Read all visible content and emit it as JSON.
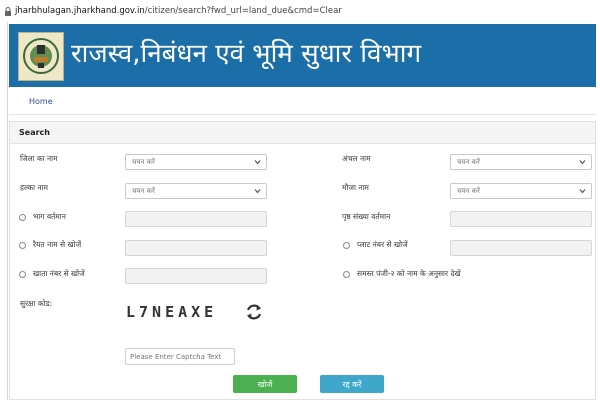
{
  "browser": {
    "url_host": "jharbhulagan.jharkhand.gov.in",
    "url_path": "/citizen/search?fwd_url=land_due&cmd=Clear"
  },
  "header": {
    "title": "राजस्व,निबंधन एवं भूमि सुधार विभाग"
  },
  "nav": {
    "home_label": "Home"
  },
  "search": {
    "heading": "Search",
    "district_label": "जिला का नाम",
    "district_value": "चयन करें",
    "circle_label": "अंचल नाम",
    "circle_value": "चयन करें",
    "halka_label": "हल्का नाम",
    "halka_value": "चयन करें",
    "mauza_label": "मौजा नाम",
    "mauza_value": "चयन करें",
    "bhag_label": "भाग वर्तमान",
    "page_label": "पृष्ठ संख्या वर्तमान",
    "raiyat_label": "रैयत नाम से खोजें",
    "plot_label": "प्लाट नंबर से खोजें",
    "khata_label": "खाता नंबर से खोजें",
    "panji_label": "समस्त पंजी-२ को नाम के अनुसार देखें",
    "captcha_label": "सुरक्षा कोड:",
    "captcha_value": "L7NEAXE",
    "captcha_placeholder": "Please Enter Captcha Text",
    "search_button": "खोजें",
    "cancel_button": "रद्द करें"
  },
  "colors": {
    "banner": "#1b6ea8",
    "search_button": "#4caf50",
    "cancel_button": "#3fa7c9"
  }
}
